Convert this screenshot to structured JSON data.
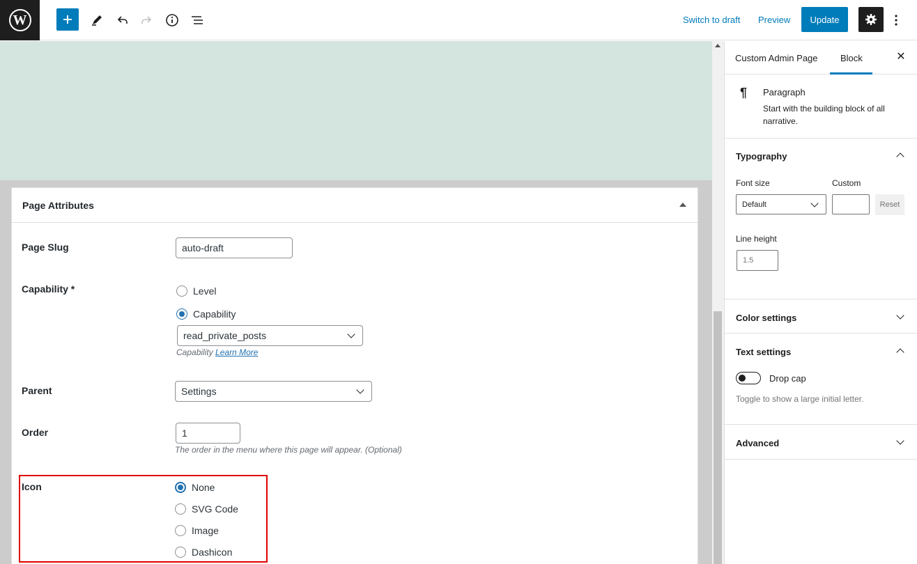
{
  "topbar": {
    "logo_icon": "wordpress-logo",
    "switch_to_draft": "Switch to draft",
    "preview": "Preview",
    "update": "Update",
    "accent_color": "#007cba"
  },
  "metabox": {
    "title": "Page Attributes",
    "page_slug": {
      "label": "Page Slug",
      "value": "auto-draft"
    },
    "capability": {
      "label": "Capability *",
      "options": [
        "Level",
        "Capability"
      ],
      "selected": "Capability",
      "select_value": "read_private_posts",
      "desc_prefix": "Capability",
      "desc_link": "Learn More"
    },
    "parent": {
      "label": "Parent",
      "value": "Settings"
    },
    "order": {
      "label": "Order",
      "value": "1",
      "desc": "The order in the menu where this page will appear. (Optional)"
    },
    "icon": {
      "label": "Icon",
      "options": [
        "None",
        "SVG Code",
        "Image",
        "Dashicon"
      ],
      "selected": "None",
      "highlight_color": "#e00000"
    }
  },
  "sidebar": {
    "tabs": [
      "Custom Admin Page",
      "Block"
    ],
    "active_tab": "Block",
    "block": {
      "icon": "paragraph-icon",
      "name": "Paragraph",
      "description": "Start with the building block of all narrative."
    },
    "typography": {
      "title": "Typography",
      "font_size_label": "Font size",
      "custom_label": "Custom",
      "font_size_value": "Default",
      "custom_value": "",
      "reset": "Reset",
      "line_height_label": "Line height",
      "line_height_placeholder": "1.5"
    },
    "color_settings": "Color settings",
    "text_settings": {
      "title": "Text settings",
      "drop_cap_label": "Drop cap",
      "drop_cap_help": "Toggle to show a large initial letter."
    },
    "advanced": "Advanced"
  }
}
